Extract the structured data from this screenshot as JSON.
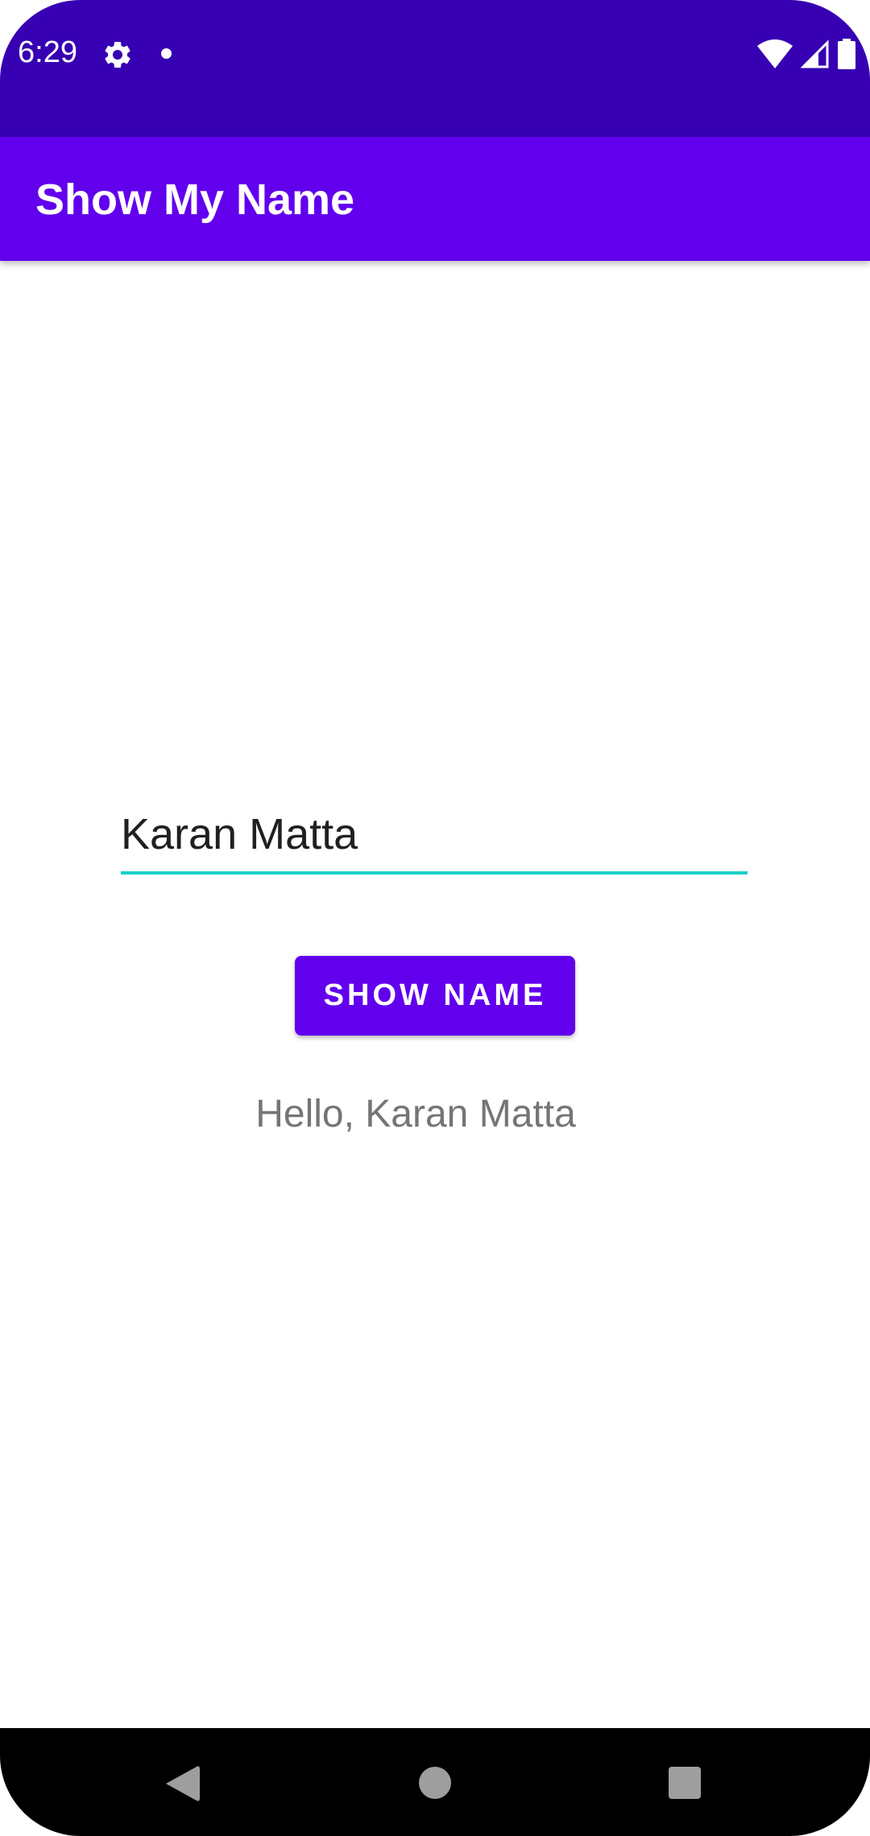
{
  "status_bar": {
    "time": "6:29",
    "icons": [
      "gear-icon",
      "notification-dot-icon",
      "wifi-icon",
      "cellular-signal-icon",
      "battery-icon"
    ],
    "background_color": "#3700b3"
  },
  "app_bar": {
    "title": "Show My Name",
    "background_color": "#6200ee"
  },
  "form": {
    "name_input_value": "Karan Matta",
    "input_underline_color": "#18d0c8",
    "show_button_label": "SHOW NAME",
    "greeting_text": "Hello, Karan Matta"
  },
  "nav_bar": {
    "icons": [
      "back-icon",
      "home-icon",
      "recents-icon"
    ]
  }
}
